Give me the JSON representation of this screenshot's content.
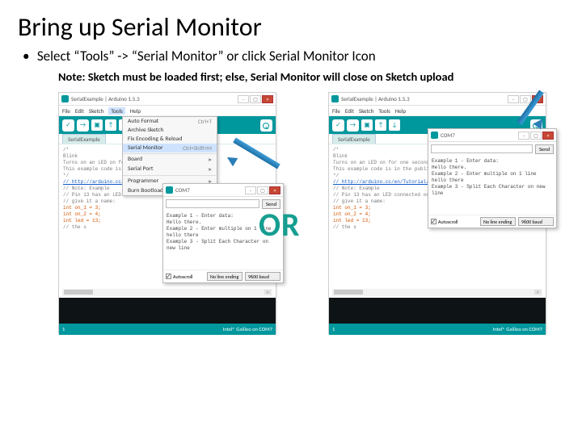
{
  "slide": {
    "title": "Bring up Serial Monitor",
    "bullet": "Select “Tools” -> “Serial Monitor” or click Serial Monitor Icon",
    "note": "Note: Sketch must be loaded first; else, Serial Monitor will close on Sketch upload",
    "or": "OR"
  },
  "ide": {
    "window_title": "SerialExample | Arduino 1.5.3",
    "menus": [
      "File",
      "Edit",
      "Sketch",
      "Tools",
      "Help"
    ],
    "tab": "SerialExample",
    "tools_menu": {
      "items": [
        {
          "label": "Auto Format",
          "shortcut": "Ctrl+T"
        },
        {
          "label": "Archive Sketch"
        },
        {
          "label": "Fix Encoding & Reload"
        },
        {
          "label": "Serial Monitor",
          "shortcut": "Ctrl+Shift+M",
          "highlight": true
        }
      ],
      "items2": [
        {
          "label": "Board",
          "sub": true
        },
        {
          "label": "Serial Port",
          "sub": true
        }
      ],
      "items3": [
        {
          "label": "Programmer",
          "sub": true
        },
        {
          "label": "Burn Bootloader"
        }
      ]
    },
    "code_lines": [
      {
        "t": "/*",
        "cls": "cmt"
      },
      {
        "t": "  Blink",
        "cls": "cmt"
      },
      {
        "t": "  Turns on an LED on for one second, repea",
        "cls": "cmt"
      },
      {
        "t": "",
        "cls": ""
      },
      {
        "t": "  This example code is in the public doma",
        "cls": "cmt"
      },
      {
        "t": " */",
        "cls": "cmt"
      },
      {
        "t": "",
        "cls": ""
      },
      {
        "t": "// http://arduino.cc/en/Tutorial/Blink",
        "cls": "url"
      },
      {
        "t": "",
        "cls": ""
      },
      {
        "t": "// Note: Example",
        "cls": "cmt"
      },
      {
        "t": "",
        "cls": ""
      },
      {
        "t": "// Pin 13 has an LED connected on most",
        "cls": "cmt"
      },
      {
        "t": "// give it a name:",
        "cls": "cmt"
      },
      {
        "t": "int on_1 = 3;",
        "cls": "kw"
      },
      {
        "t": "int on_2 = 4;",
        "cls": "kw"
      },
      {
        "t": "int led = 13;",
        "cls": "kw"
      },
      {
        "t": "// the s",
        "cls": "cmt"
      }
    ],
    "status_left": "1",
    "status_right": "Intel® Galileo on COM7"
  },
  "serial_monitor": {
    "title": "COM7",
    "send": "Send",
    "lines": [
      "Example 1 - Enter data:",
      "Hello there.",
      "",
      "Example 2 - Enter multiple on 1 line",
      "hello there",
      "",
      "Example 3 - Split Each Character on new line"
    ],
    "autoscroll": "Autoscroll",
    "line_ending": "No line ending",
    "baud": "9600 baud"
  }
}
